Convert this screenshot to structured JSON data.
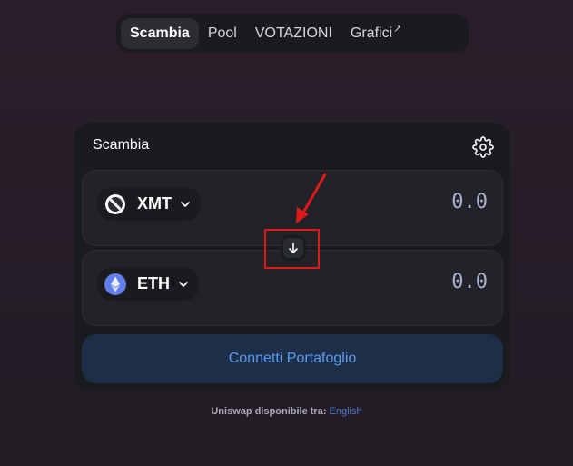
{
  "nav": {
    "items": [
      {
        "label": "Scambia",
        "active": true
      },
      {
        "label": "Pool",
        "active": false
      },
      {
        "label": "VOTAZIONI",
        "active": false
      },
      {
        "label": "Grafici",
        "active": false,
        "external_glyph": "↗"
      }
    ]
  },
  "card": {
    "title": "Scambia",
    "settings_icon": "gear-icon",
    "input": {
      "token": "XMT",
      "icon": "no-entry-icon",
      "amount": "0.0"
    },
    "output": {
      "token": "ETH",
      "icon": "ethereum-icon",
      "amount": "0.0"
    },
    "swap_direction_icon": "arrow-down-icon",
    "connect_label": "Connetti Portafoglio"
  },
  "footer": {
    "text": "Uniswap disponibile tra:",
    "language_link": "English"
  },
  "colors": {
    "accent": "#5d9bef",
    "annotation": "#e01818",
    "background": "#2b1e2a",
    "card": "#191b1f"
  }
}
